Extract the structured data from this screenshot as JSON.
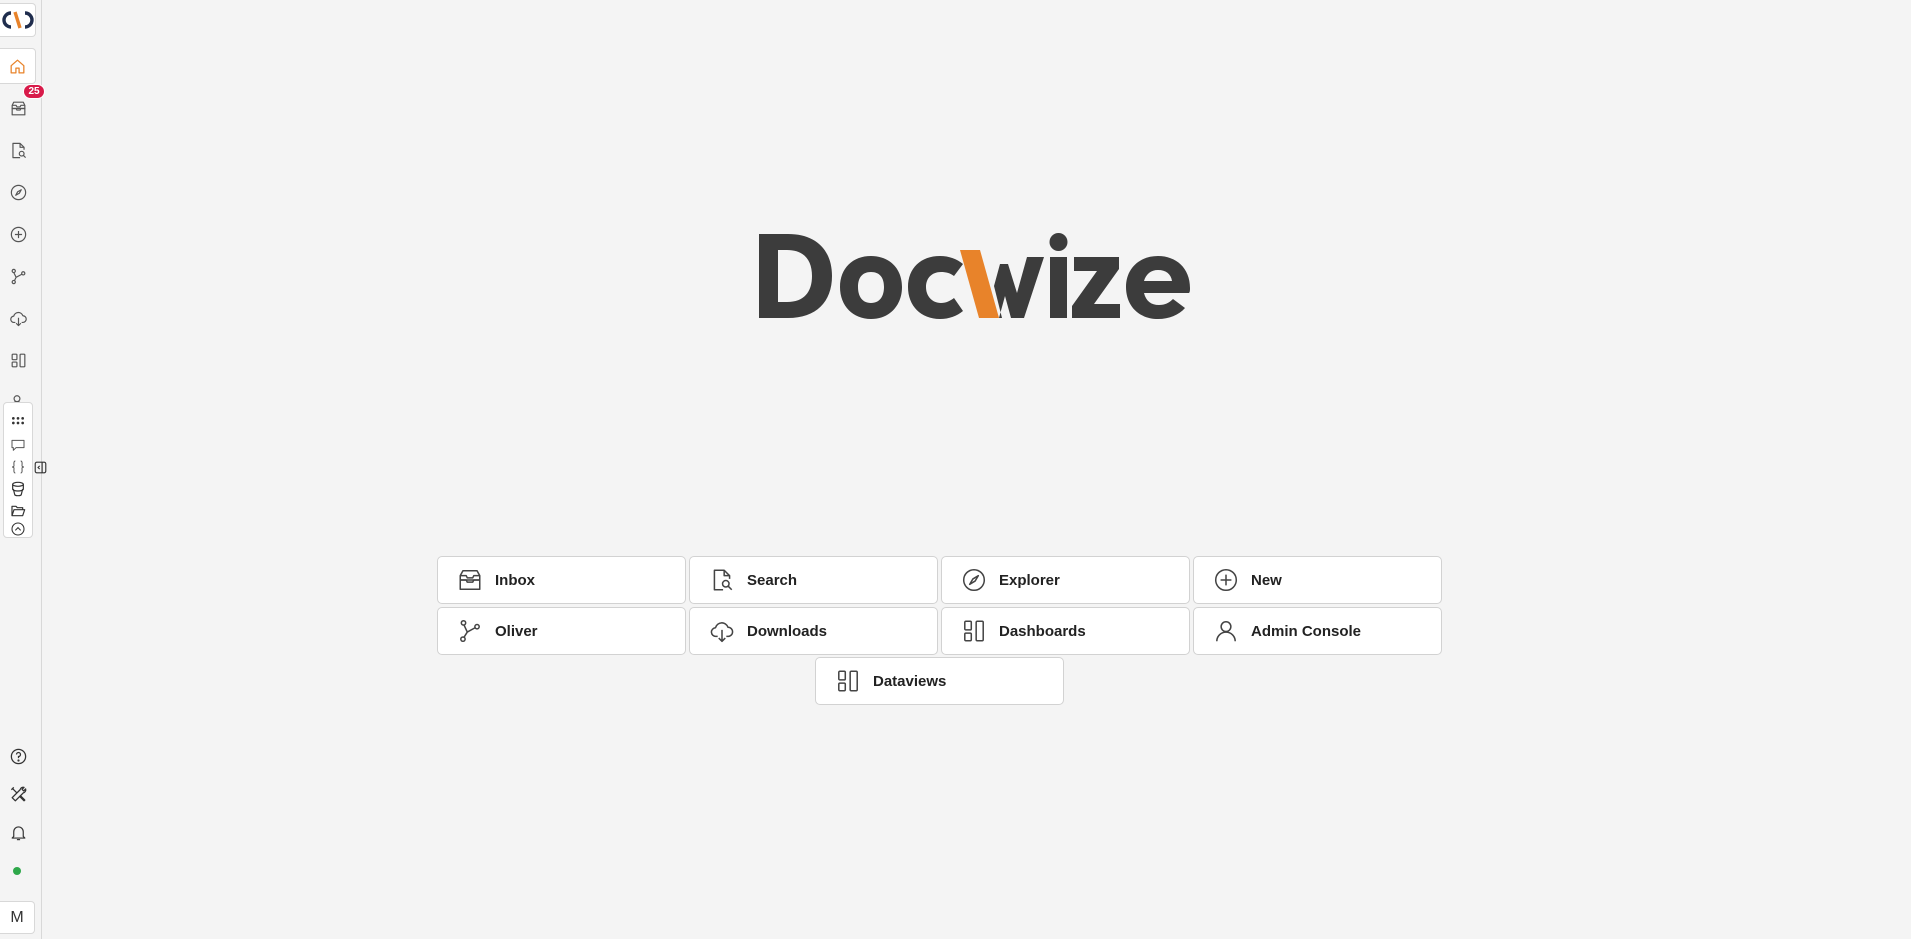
{
  "brand": {
    "name": "Docwize",
    "accent_color": "#e8832a",
    "text_color": "#3c3c3c"
  },
  "sidebar": {
    "items": [
      {
        "id": "home",
        "icon": "home-icon",
        "active": true
      },
      {
        "id": "inbox",
        "icon": "inbox-icon",
        "badge": "25"
      },
      {
        "id": "search",
        "icon": "document-search-icon"
      },
      {
        "id": "explorer",
        "icon": "compass-icon"
      },
      {
        "id": "new",
        "icon": "plus-circle-icon"
      },
      {
        "id": "oliver",
        "icon": "workflow-icon"
      },
      {
        "id": "downloads",
        "icon": "cloud-download-icon"
      },
      {
        "id": "dashboards",
        "icon": "dashboard-icon"
      }
    ],
    "app_panel": [
      {
        "id": "apps",
        "icon": "apps-grid-icon"
      },
      {
        "id": "comments",
        "icon": "chat-icon"
      },
      {
        "id": "code",
        "icon": "braces-icon"
      },
      {
        "id": "database",
        "icon": "database-icon"
      },
      {
        "id": "folder",
        "icon": "folder-open-icon"
      },
      {
        "id": "more",
        "icon": "chevron-up-circle-icon"
      }
    ],
    "bottom": [
      {
        "id": "help",
        "icon": "help-icon"
      },
      {
        "id": "tools",
        "icon": "tools-icon"
      },
      {
        "id": "notifications",
        "icon": "bell-icon"
      }
    ],
    "status_color": "#2ea84a",
    "avatar_initial": "M",
    "badge_color": "#d81b4a"
  },
  "tiles": [
    {
      "label": "Inbox",
      "icon": "inbox-icon"
    },
    {
      "label": "Search",
      "icon": "document-search-icon"
    },
    {
      "label": "Explorer",
      "icon": "compass-icon"
    },
    {
      "label": "New",
      "icon": "plus-circle-icon"
    },
    {
      "label": "Oliver",
      "icon": "workflow-icon"
    },
    {
      "label": "Downloads",
      "icon": "cloud-download-icon"
    },
    {
      "label": "Dashboards",
      "icon": "dashboard-icon"
    },
    {
      "label": "Admin Console",
      "icon": "user-icon"
    },
    {
      "label": "Dataviews",
      "icon": "dashboard-icon"
    }
  ]
}
